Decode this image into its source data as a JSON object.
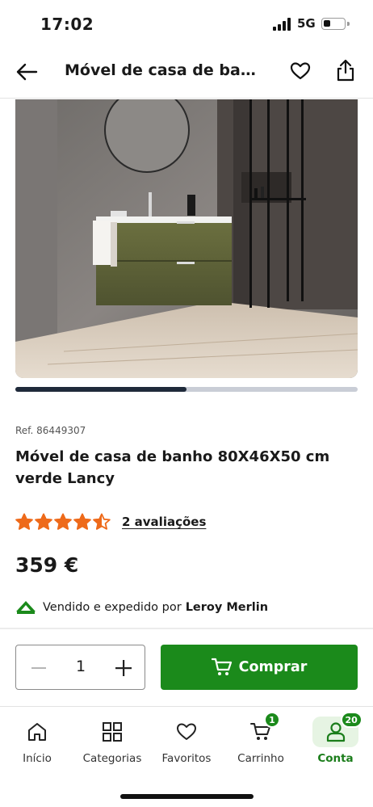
{
  "status_bar": {
    "time": "17:02",
    "network": "5G",
    "battery_level": 0.35
  },
  "header": {
    "back_icon": "arrow-left-icon",
    "title": "Móvel de casa de banho 80X46X50 cm verde Lancy",
    "favorite_icon": "heart-outline-icon",
    "share_icon": "share-icon"
  },
  "gallery": {
    "image_index_progress": 0.5
  },
  "product": {
    "ref": "Ref. 86449307",
    "title": "Móvel de casa de banho 80X46X50 cm verde Lancy",
    "rating": 4.5,
    "rating_max": 5,
    "reviews_link": "2 avaliações",
    "price": "359 €",
    "seller_prefix": "Vendido e expedido por",
    "seller_name": "Leroy Merlin"
  },
  "purchase": {
    "quantity": "1",
    "buy_label": "Comprar"
  },
  "tabbar": {
    "items": [
      {
        "label": "Início",
        "icon": "home-icon"
      },
      {
        "label": "Categorias",
        "icon": "grid-icon"
      },
      {
        "label": "Favoritos",
        "icon": "heart-outline-icon"
      },
      {
        "label": "Carrinho",
        "icon": "cart-icon",
        "badge": "1"
      },
      {
        "label": "Conta",
        "icon": "user-icon",
        "badge": "20",
        "active": true
      }
    ]
  },
  "colors": {
    "brand_green": "#1b8a1b",
    "star_orange": "#ee6a1a",
    "active_tab_bg": "#e6f4e3"
  }
}
